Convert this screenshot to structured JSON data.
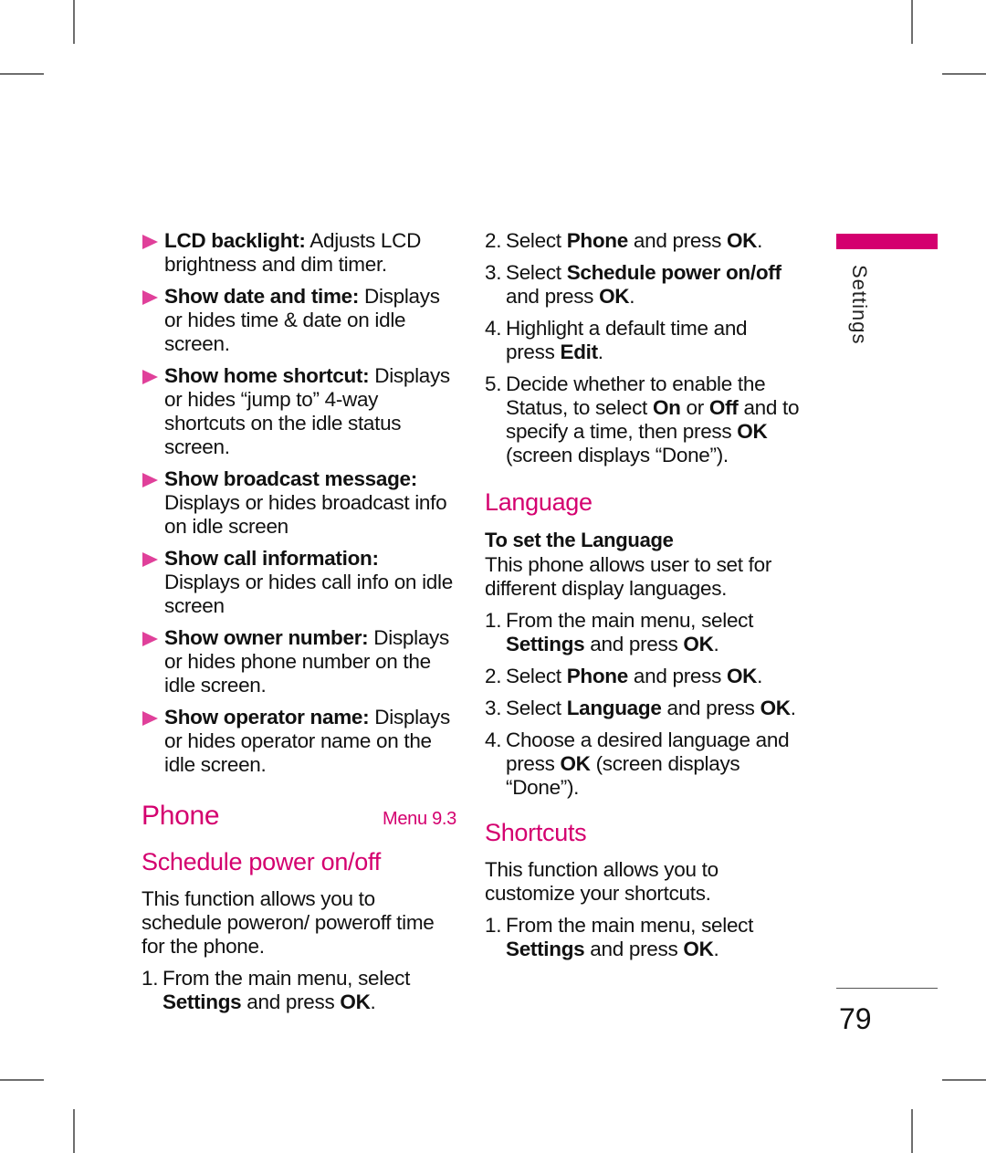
{
  "left_column": {
    "bullets": [
      {
        "term": "LCD backlight:",
        "text": " Adjusts LCD brightness and dim timer."
      },
      {
        "term": "Show date and time:",
        "text": " Displays or hides time & date on idle screen."
      },
      {
        "term": "Show home shortcut:",
        "text": " Displays or hides “jump to” 4-way shortcuts on the idle status screen."
      },
      {
        "term": "Show broadcast message:",
        "text": " Displays or hides broadcast info on idle screen"
      },
      {
        "term": "Show call information:",
        "text": " Displays or hides call info on idle screen"
      },
      {
        "term": "Show owner number:",
        "text": " Displays or hides phone number on the idle screen."
      },
      {
        "term": "Show operator name:",
        "text": " Displays or hides operator name on the idle screen."
      }
    ],
    "phone_heading": "Phone",
    "menu_ref": "Menu 9.3",
    "schedule_heading": "Schedule power on/off",
    "schedule_intro": "This function allows you to schedule poweron/ poweroff time for the phone.",
    "schedule_step1": {
      "num": "1.",
      "a": "From the main menu, select ",
      "b1": "Settings",
      "c": " and press ",
      "b2": "OK",
      "d": "."
    }
  },
  "right_column": {
    "schedule_steps": [
      {
        "num": "2.",
        "a": "Select ",
        "b1": "Phone",
        "c": " and press ",
        "b2": "OK",
        "d": "."
      },
      {
        "num": "3.",
        "a": "Select ",
        "b1": "Schedule power on/off",
        "c": " and press ",
        "b2": "OK",
        "d": "."
      },
      {
        "num": "4.",
        "a": "Highlight a default time and press ",
        "b1": "Edit",
        "c": ".",
        "b2": "",
        "d": ""
      },
      {
        "num": "5.",
        "a": "Decide whether to enable the Status, to select ",
        "b1": "On",
        "c": " or ",
        "b2": "Off",
        "d": " and to specify a time, then press ",
        "b3": "OK",
        "e": " (screen displays “Done”)."
      }
    ],
    "language_heading": "Language",
    "language_subheading": "To set the Language",
    "language_intro": "This phone allows user to set for different display languages.",
    "language_steps": [
      {
        "num": "1.",
        "a": "From the main menu, select ",
        "b1": "Settings",
        "c": " and press ",
        "b2": "OK",
        "d": "."
      },
      {
        "num": "2.",
        "a": "Select ",
        "b1": "Phone",
        "c": " and press ",
        "b2": "OK",
        "d": "."
      },
      {
        "num": "3.",
        "a": "Select ",
        "b1": "Language",
        "c": " and press ",
        "b2": "OK",
        "d": "."
      },
      {
        "num": "4.",
        "a": "Choose a desired language and press ",
        "b1": "OK",
        "c": " (screen displays “Done”).",
        "b2": "",
        "d": ""
      }
    ],
    "shortcuts_heading": "Shortcuts",
    "shortcuts_intro": "This function allows you to customize your shortcuts.",
    "shortcuts_steps": [
      {
        "num": "1.",
        "a": "From the main menu, select ",
        "b1": "Settings",
        "c": " and press ",
        "b2": "OK",
        "d": "."
      }
    ]
  },
  "sidebar": {
    "section_label": "Settings",
    "accent_color": "#d4006f"
  },
  "footer": {
    "page_number": "79"
  }
}
